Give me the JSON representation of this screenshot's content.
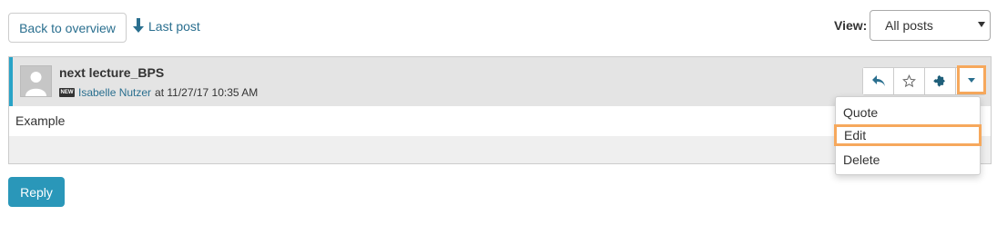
{
  "nav": {
    "back_label": "Back to overview",
    "last_post_label": "Last post"
  },
  "view": {
    "label": "View:",
    "selected": "All posts"
  },
  "post": {
    "title": "next lecture_BPS",
    "new_badge": "NEW",
    "author": "Isabelle Nutzer",
    "timestamp": "at 11/27/17 10:35 AM",
    "body": "Example"
  },
  "menu": {
    "items": [
      "Quote",
      "Edit",
      "Delete"
    ]
  },
  "reply_label": "Reply",
  "colors": {
    "accent": "#28a3c7",
    "link": "#2a6f8f",
    "highlight": "#f6a85c",
    "reply_button": "#2a97b9"
  }
}
